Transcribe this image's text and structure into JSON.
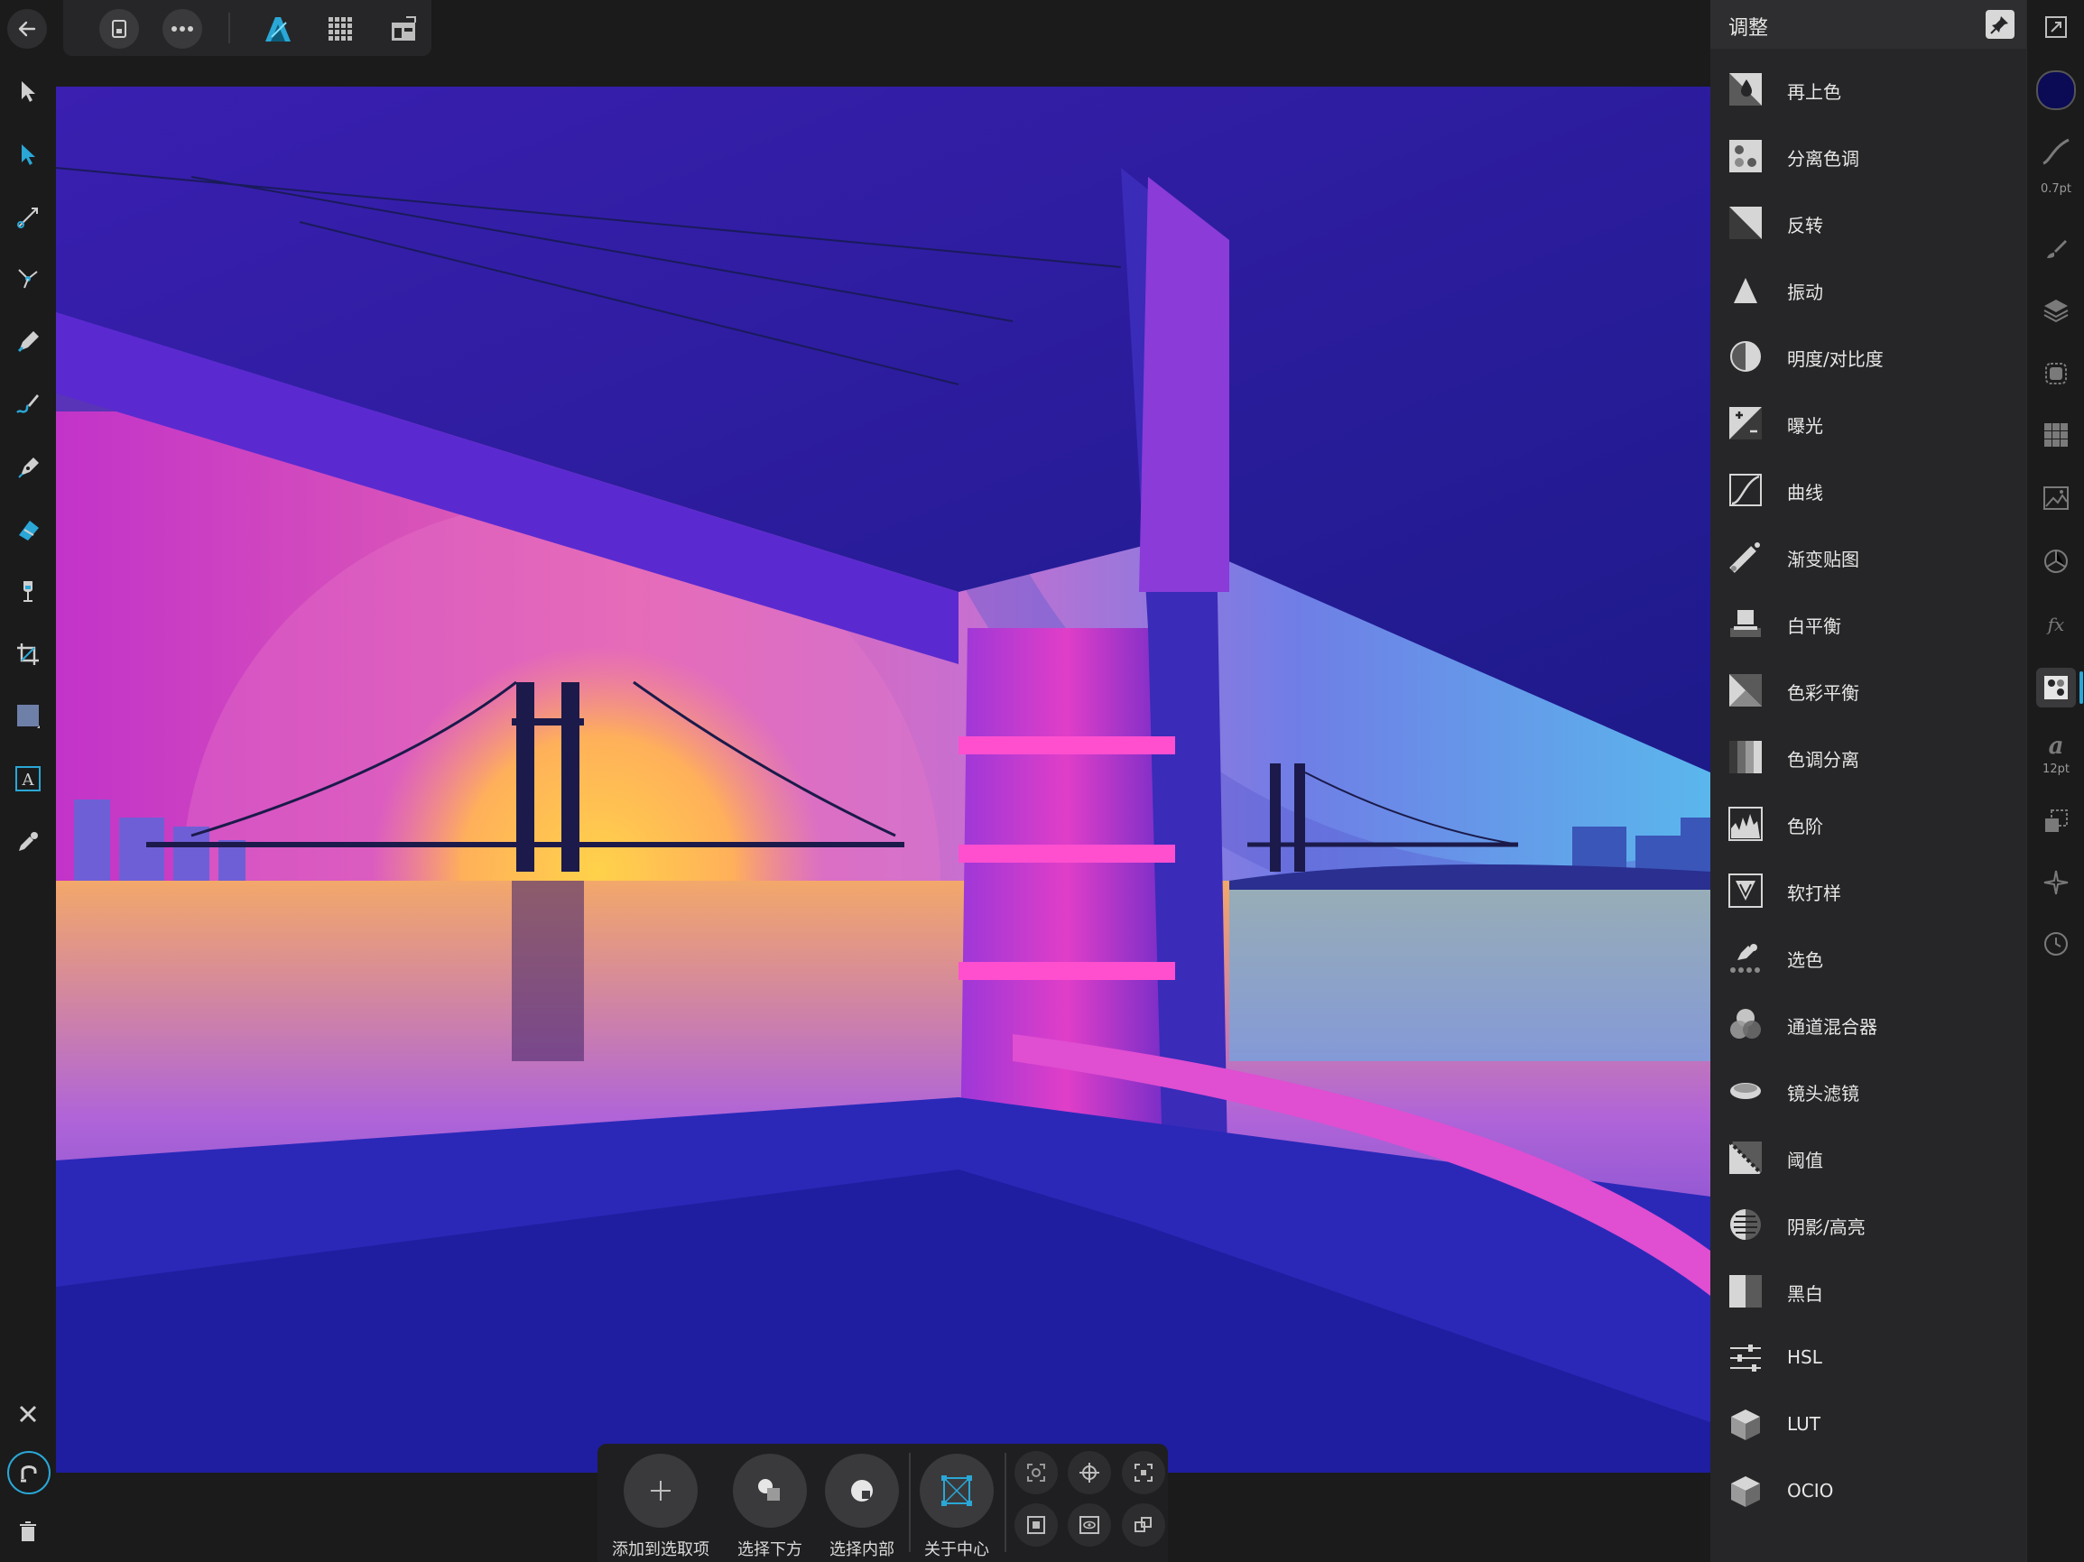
{
  "panel": {
    "title": "调整",
    "items": [
      {
        "label": "再上色",
        "icon": "recolor-icon"
      },
      {
        "label": "分离色调",
        "icon": "split-toning-icon"
      },
      {
        "label": "反转",
        "icon": "invert-icon"
      },
      {
        "label": "振动",
        "icon": "vibrance-icon"
      },
      {
        "label": "明度/对比度",
        "icon": "brightness-contrast-icon"
      },
      {
        "label": "曝光",
        "icon": "exposure-icon"
      },
      {
        "label": "曲线",
        "icon": "curves-icon"
      },
      {
        "label": "渐变贴图",
        "icon": "gradient-map-icon"
      },
      {
        "label": "白平衡",
        "icon": "white-balance-icon"
      },
      {
        "label": "色彩平衡",
        "icon": "color-balance-icon"
      },
      {
        "label": "色调分离",
        "icon": "posterize-icon"
      },
      {
        "label": "色阶",
        "icon": "levels-icon"
      },
      {
        "label": "软打样",
        "icon": "soft-proof-icon"
      },
      {
        "label": "选色",
        "icon": "selective-color-icon"
      },
      {
        "label": "通道混合器",
        "icon": "channel-mixer-icon"
      },
      {
        "label": "镜头滤镜",
        "icon": "lens-filter-icon"
      },
      {
        "label": "阈值",
        "icon": "threshold-icon"
      },
      {
        "label": "阴影/高亮",
        "icon": "shadows-highlights-icon"
      },
      {
        "label": "黑白",
        "icon": "black-white-icon"
      },
      {
        "label": "HSL",
        "icon": "hsl-icon"
      },
      {
        "label": "LUT",
        "icon": "lut-icon"
      },
      {
        "label": "OCIO",
        "icon": "ocio-icon"
      }
    ]
  },
  "rightbar": {
    "stroke_width": "0.7pt",
    "font_size": "12pt",
    "fill_color": "#0a0a55"
  },
  "context": {
    "add_to_selection": "添加到选取项",
    "select_under": "选择下方",
    "select_inside": "选择内部",
    "about_center": "关于中心"
  },
  "colors": {
    "accent": "#2aa7d6",
    "panel_bg": "#262628",
    "app_bg": "#1b1b1c"
  }
}
